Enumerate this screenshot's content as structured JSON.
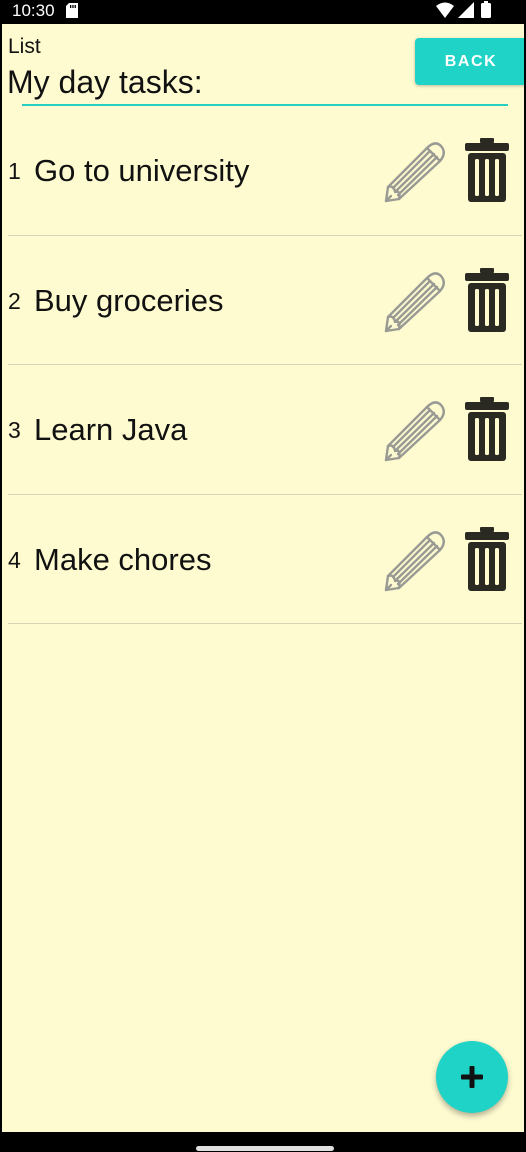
{
  "status_bar": {
    "time": "10:30",
    "icons": [
      "sd-card-icon",
      "wifi-icon",
      "signal-icon",
      "battery-icon"
    ]
  },
  "header": {
    "label": "List",
    "title": "My day tasks:",
    "back_label": "BACK"
  },
  "tasks": [
    {
      "number": "1",
      "name": "Go to university"
    },
    {
      "number": "2",
      "name": "Buy groceries"
    },
    {
      "number": "3",
      "name": "Learn Java"
    },
    {
      "number": "4",
      "name": "Make chores"
    }
  ],
  "fab": {
    "icon": "plus-icon"
  },
  "colors": {
    "background": "#fefbd0",
    "accent": "#1fd3c6",
    "text": "#111111",
    "trash": "#2b2a22",
    "pencil": "#9a9a94"
  }
}
